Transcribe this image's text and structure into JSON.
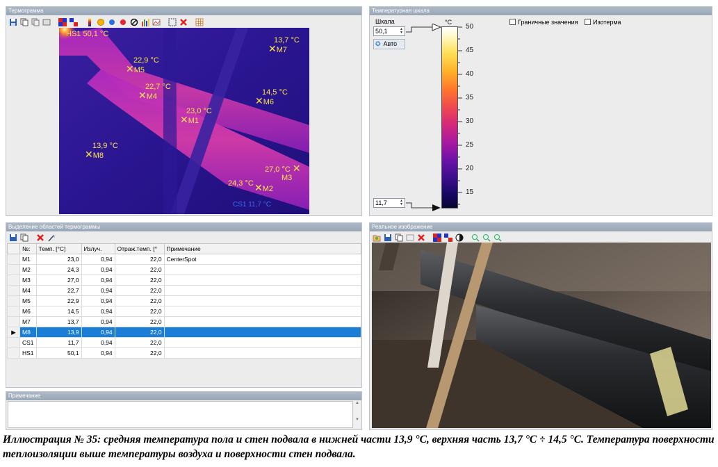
{
  "thermogram_panel": {
    "title": "Термограмма",
    "toolbar_icons": [
      "save-icon",
      "copy-icon",
      "copy2-icon",
      "copy3-icon",
      "palette-icon",
      "palette2-icon",
      "scale-icon",
      "sun-icon",
      "blue-dot-icon",
      "red-dot-icon",
      "no-icon",
      "bars-icon",
      "gradient-icon",
      "select-icon",
      "delete-icon",
      "grid-icon"
    ],
    "markers": [
      {
        "id": "hs1",
        "label": "HS1 50,1 °C"
      },
      {
        "id": "m7",
        "temp": "13,7 °C",
        "name": "M7"
      },
      {
        "id": "m5",
        "temp": "22,9 °C",
        "name": "M5"
      },
      {
        "id": "m4",
        "temp": "22,7 °C",
        "name": "M4"
      },
      {
        "id": "m6",
        "temp": "14,5 °C",
        "name": "M6"
      },
      {
        "id": "m1",
        "temp": "23,0 °C",
        "name": "M1"
      },
      {
        "id": "m8",
        "temp": "13,9 °C",
        "name": "M8"
      },
      {
        "id": "m3",
        "temp": "27,0 °C",
        "name": "M3"
      },
      {
        "id": "m2",
        "temp": "24,3 °C",
        "name": "M2"
      },
      {
        "id": "cs1",
        "label": "CS1 11,7 °C"
      }
    ]
  },
  "scale_panel": {
    "title": "Температурная шкала",
    "scale_label": "Шкала",
    "max_value": "50,1",
    "min_value": "11,7",
    "auto_label": "Авто",
    "unit": "°C",
    "ticks": [
      "50",
      "45",
      "40",
      "35",
      "30",
      "25",
      "20",
      "15"
    ],
    "boundary_label": "Граничные значения",
    "isotherm_label": "Изотерма"
  },
  "regions_panel": {
    "title": "Выделение областей термограммы",
    "columns": [
      "№:",
      "Темп. [°C]",
      "Излуч.",
      "Отраж.темп. [°",
      "Примечание"
    ],
    "rows": [
      {
        "n": "M1",
        "temp": "23,0",
        "emis": "0,94",
        "refl": "22,0",
        "note": "CenterSpot"
      },
      {
        "n": "M2",
        "temp": "24,3",
        "emis": "0,94",
        "refl": "22,0",
        "note": ""
      },
      {
        "n": "M3",
        "temp": "27,0",
        "emis": "0,94",
        "refl": "22,0",
        "note": ""
      },
      {
        "n": "M4",
        "temp": "22,7",
        "emis": "0,94",
        "refl": "22,0",
        "note": ""
      },
      {
        "n": "M5",
        "temp": "22,9",
        "emis": "0,94",
        "refl": "22,0",
        "note": ""
      },
      {
        "n": "M6",
        "temp": "14,5",
        "emis": "0,94",
        "refl": "22,0",
        "note": ""
      },
      {
        "n": "M7",
        "temp": "13,7",
        "emis": "0,94",
        "refl": "22,0",
        "note": ""
      },
      {
        "n": "M8",
        "temp": "13,9",
        "emis": "0,94",
        "refl": "22,0",
        "note": ""
      },
      {
        "n": "CS1",
        "temp": "11,7",
        "emis": "0,94",
        "refl": "22,0",
        "note": ""
      },
      {
        "n": "HS1",
        "temp": "50,1",
        "emis": "0,94",
        "refl": "22,0",
        "note": ""
      }
    ],
    "selected_row": "M8"
  },
  "note_panel": {
    "title": "Примечание"
  },
  "real_image_panel": {
    "title": "Реальное изображение"
  },
  "caption": "Иллюстрация № 35: средняя температура пола и стен подвала в нижней части 13,9 °С, верхняя часть 13,7 °С ÷ 14,5 °С. Температура поверхности теплоизоляции выше температуры воздуха и поверхности стен подвала.",
  "colors": {
    "selection": "#1a7ed6",
    "marker": "#ffe44a",
    "panel_title": "#a3afbd"
  }
}
